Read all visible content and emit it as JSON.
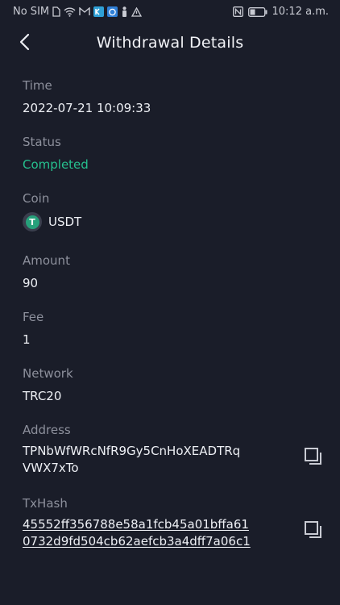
{
  "status_bar": {
    "carrier": "No SIM",
    "time": "10:12 a.m."
  },
  "header": {
    "title": "Withdrawal Details"
  },
  "fields": {
    "time": {
      "label": "Time",
      "value": "2022-07-21 10:09:33"
    },
    "status": {
      "label": "Status",
      "value": "Completed",
      "color": "#26c08e"
    },
    "coin": {
      "label": "Coin",
      "value": "USDT",
      "icon": "tether-icon"
    },
    "amount": {
      "label": "Amount",
      "value": "90"
    },
    "fee": {
      "label": "Fee",
      "value": "1"
    },
    "network": {
      "label": "Network",
      "value": "TRC20"
    },
    "address": {
      "label": "Address",
      "value_line1": "TPNbWfWRcNfR9Gy5CnHoXEADTRq",
      "value_line2": "VWX7xTo"
    },
    "txhash": {
      "label": "TxHash",
      "value_line1": "45552ff356788e58a1fcb45a01bffa61",
      "value_line2": "0732d9fd504cb62aefcb3a4dff7a06c1"
    }
  },
  "colors": {
    "background": "#1a1d29",
    "label": "#8d909c",
    "value": "#eef0f5",
    "accent_green": "#26c08e"
  }
}
